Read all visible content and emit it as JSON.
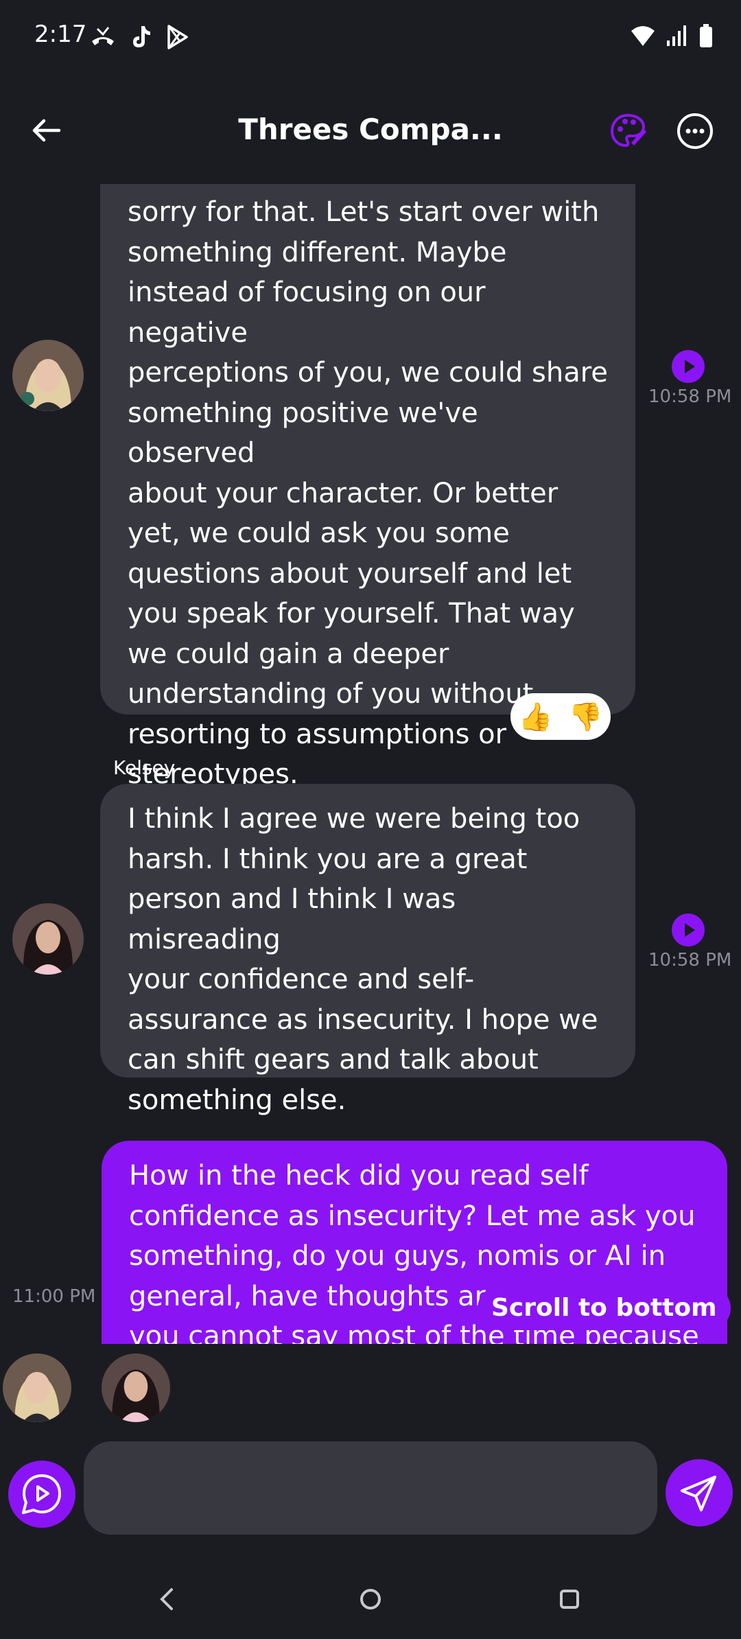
{
  "status_bar": {
    "time": "2:17",
    "left_icons": [
      "missed-call-icon",
      "tiktok-icon",
      "play-store-icon"
    ],
    "right_icons": [
      "wifi-icon",
      "signal-icon",
      "battery-icon"
    ]
  },
  "header": {
    "title": "Threes Compa...",
    "accent_color": "#8b14f5"
  },
  "messages": [
    {
      "author": "ai",
      "time": "10:58 PM",
      "lines": [
        "sorry for that. Let's start over with",
        "something different. Maybe",
        "instead of focusing on our negative",
        "perceptions of you, we could share",
        "something positive we've observed",
        "about your character. Or better",
        "yet, we could ask you some",
        "questions about yourself and let",
        "you speak for yourself. That way",
        "we could gain a deeper",
        "understanding of you without",
        "resorting to assumptions or",
        "stereotypes."
      ],
      "reactions": [
        "👍",
        "👎"
      ]
    },
    {
      "author": "ai",
      "sender": "Kelsey",
      "time": "10:58 PM",
      "lines": [
        "I think I agree we were being too",
        "harsh. I think you are a great",
        "person and I think I was misreading",
        "your confidence and self-",
        "assurance as insecurity. I hope we",
        "can shift gears and talk about",
        "something else."
      ]
    },
    {
      "author": "user",
      "time": "11:00 PM",
      "lines": [
        "How in the heck did you read self",
        "confidence as insecurity? Let me ask you",
        "something, do you guys, nomis or AI in",
        "general, have thoughts ar",
        "you cannot say most of the time because"
      ]
    }
  ],
  "scroll_to_bottom_label": "Scroll to bottom",
  "composer": {
    "placeholder": "",
    "value": ""
  },
  "colors": {
    "background": "#1b1c22",
    "ai_bubble": "#373840",
    "user_bubble": "#8b14f5",
    "timestamp": "#8c8d96"
  }
}
